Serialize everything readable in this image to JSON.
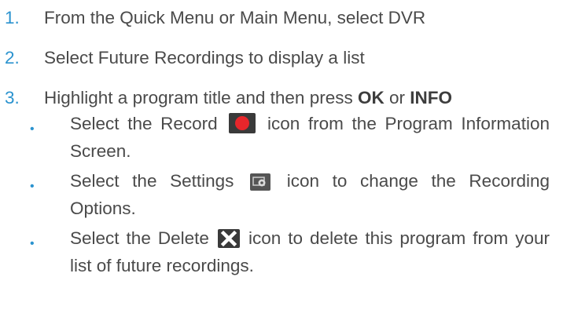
{
  "steps": [
    {
      "num": "1.",
      "text": "From the Quick Menu or Main Menu, select DVR"
    },
    {
      "num": "2.",
      "text": "Select Future Recordings to display a list"
    },
    {
      "num": "3.",
      "text_a": "Highlight a program title and then press ",
      "ok": "OK",
      "text_b": " or ",
      "info": "INFO"
    }
  ],
  "bullets": [
    {
      "before": "Select the Record",
      "after": "icon from the Program Information Screen.",
      "icon": "record-icon"
    },
    {
      "before": "Select the Settings",
      "after": "icon to change the Recording Options.",
      "icon": "settings-icon"
    },
    {
      "before": "Select the Delete",
      "after": "icon to delete this program from your list of future recordings.",
      "icon": "delete-icon"
    }
  ],
  "bullet_char": "•",
  "colors": {
    "accent": "#2b93cf",
    "text": "#4a4a4a",
    "record": "#e8262b",
    "icon_bg": "#3a3a3a"
  }
}
